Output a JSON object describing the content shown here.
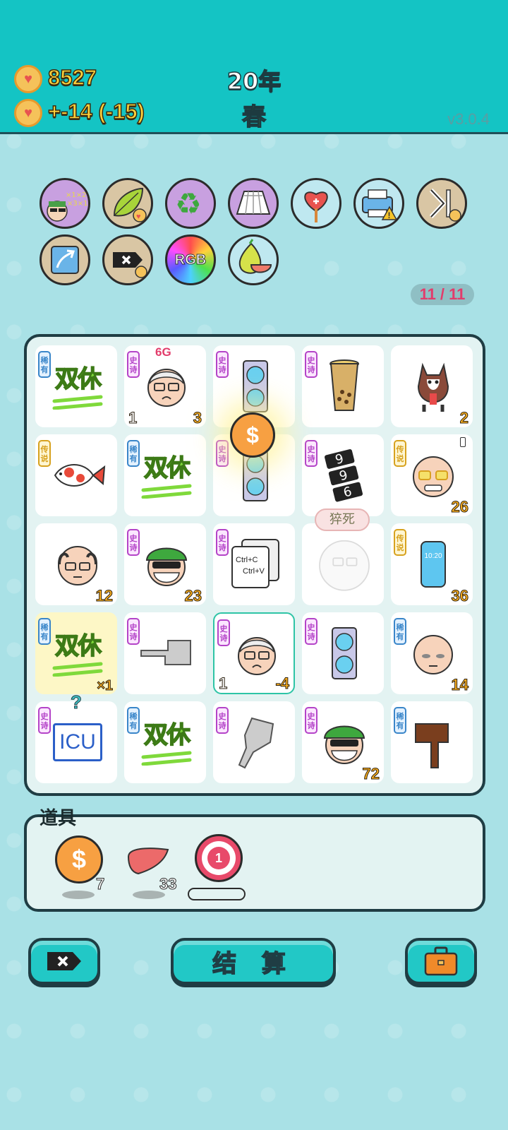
{
  "header": {
    "money": "8527",
    "income": "+-14 (-15)",
    "year": "20年",
    "season": "春",
    "version": "v3.0.4"
  },
  "relics": {
    "counter": "11 / 11",
    "row1": [
      "multiplier-face-icon",
      "leaf-coin-icon",
      "recycle-icon",
      "pleated-skirt-icon",
      "heart-fan-icon",
      "printer-warning-icon",
      "skip-icon"
    ],
    "row2": [
      "arrow-card-icon",
      "remove-coin-icon",
      "rgb-icon",
      "pomelo-icon"
    ],
    "rgb_text": "RGB"
  },
  "board": {
    "rarity": {
      "epic": "史诗",
      "rare": "稀有",
      "legend": "传说"
    },
    "double_rest": "双休",
    "cells": [
      {
        "name": "double-rest",
        "rarity": "稀有",
        "tl": "",
        "br": ""
      },
      {
        "name": "old-man-6g",
        "rarity": "史诗",
        "tl": "1",
        "br": "3",
        "top": "6G"
      },
      {
        "name": "gpu",
        "rarity": "史诗",
        "tl": "",
        "br": ""
      },
      {
        "name": "bubble-tea",
        "rarity": "史诗",
        "tl": "",
        "br": ""
      },
      {
        "name": "husky",
        "rarity": "",
        "tl": "",
        "br": "2"
      },
      {
        "name": "koi",
        "rarity": "传说",
        "tl": "",
        "br": ""
      },
      {
        "name": "double-rest",
        "rarity": "稀有",
        "tl": "",
        "br": ""
      },
      {
        "name": "gpu",
        "rarity": "史诗",
        "tl": "",
        "br": ""
      },
      {
        "name": "996",
        "rarity": "史诗",
        "tl": "",
        "br": ""
      },
      {
        "name": "grinning-man",
        "rarity": "传说",
        "tl": "",
        "br": "26"
      },
      {
        "name": "balding-man",
        "rarity": "",
        "tl": "",
        "br": "12"
      },
      {
        "name": "masked-man",
        "rarity": "史诗",
        "tl": "",
        "br": "23"
      },
      {
        "name": "ctrl-c-v",
        "rarity": "史诗",
        "tl": "",
        "br": ""
      },
      {
        "name": "dead-man",
        "rarity": "",
        "tl": "",
        "br": ""
      },
      {
        "name": "phone",
        "rarity": "传说",
        "tl": "",
        "br": "36"
      },
      {
        "name": "double-rest",
        "rarity": "稀有",
        "tl": "",
        "br": "×1"
      },
      {
        "name": "pointing-hand",
        "rarity": "史诗",
        "tl": "",
        "br": ""
      },
      {
        "name": "old-man",
        "rarity": "史诗",
        "tl": "1",
        "br": "-4"
      },
      {
        "name": "gpu",
        "rarity": "史诗",
        "tl": "",
        "br": ""
      },
      {
        "name": "bald-man",
        "rarity": "稀有",
        "tl": "",
        "br": "14"
      },
      {
        "name": "icu",
        "rarity": "史诗",
        "tl": "",
        "br": ""
      },
      {
        "name": "double-rest",
        "rarity": "稀有",
        "tl": "",
        "br": ""
      },
      {
        "name": "pointing-hand-down",
        "rarity": "史诗",
        "tl": "",
        "br": ""
      },
      {
        "name": "masked-man",
        "rarity": "史诗",
        "tl": "",
        "br": "72"
      },
      {
        "name": "brown-hand",
        "rarity": "稀有",
        "tl": "",
        "br": ""
      }
    ],
    "death_bubble": "猝死",
    "ctrl_c": "Ctrl+C",
    "ctrl_v": "Ctrl+V",
    "icu": "ICU",
    "phone_time": "10:20",
    "question": "?",
    "coin_symbol": "$"
  },
  "items": {
    "title": "道具",
    "coin_count": "7",
    "liver_count": "33",
    "target_count": "1"
  },
  "buttons": {
    "settle": "结 算"
  },
  "colors": {
    "header_bg": "#14c4c4",
    "money": "#ffd23b",
    "season": "#59d14a",
    "button": "#22c8c6"
  }
}
